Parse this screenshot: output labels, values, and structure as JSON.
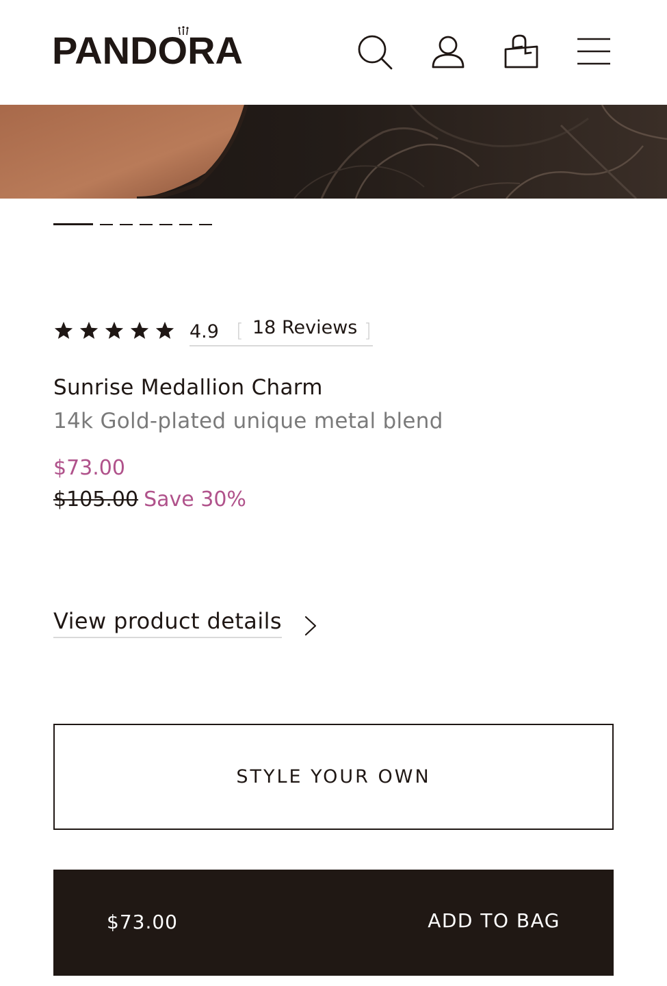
{
  "header": {
    "logo_text": "PANDORA",
    "icons": [
      "search-icon",
      "user-icon",
      "bag-icon",
      "menu-icon"
    ]
  },
  "carousel": {
    "slide_count": 7,
    "active_index": 0
  },
  "rating": {
    "stars": 5,
    "value": "4.9",
    "reviews_label": "18 Reviews"
  },
  "product": {
    "name": "Sunrise Medallion Charm",
    "material": "14k Gold-plated unique metal blend",
    "price": "$73.00",
    "original_price": "$105.00",
    "savings": "Save 30%"
  },
  "links": {
    "view_details": "View product details"
  },
  "buttons": {
    "style_your_own": "STYLE YOUR OWN",
    "add_to_bag_price": "$73.00",
    "add_to_bag": "ADD TO BAG"
  },
  "colors": {
    "text": "#1f1714",
    "accent_sale": "#b0528b",
    "button_dark": "#201814",
    "muted": "#7a7a7a"
  }
}
